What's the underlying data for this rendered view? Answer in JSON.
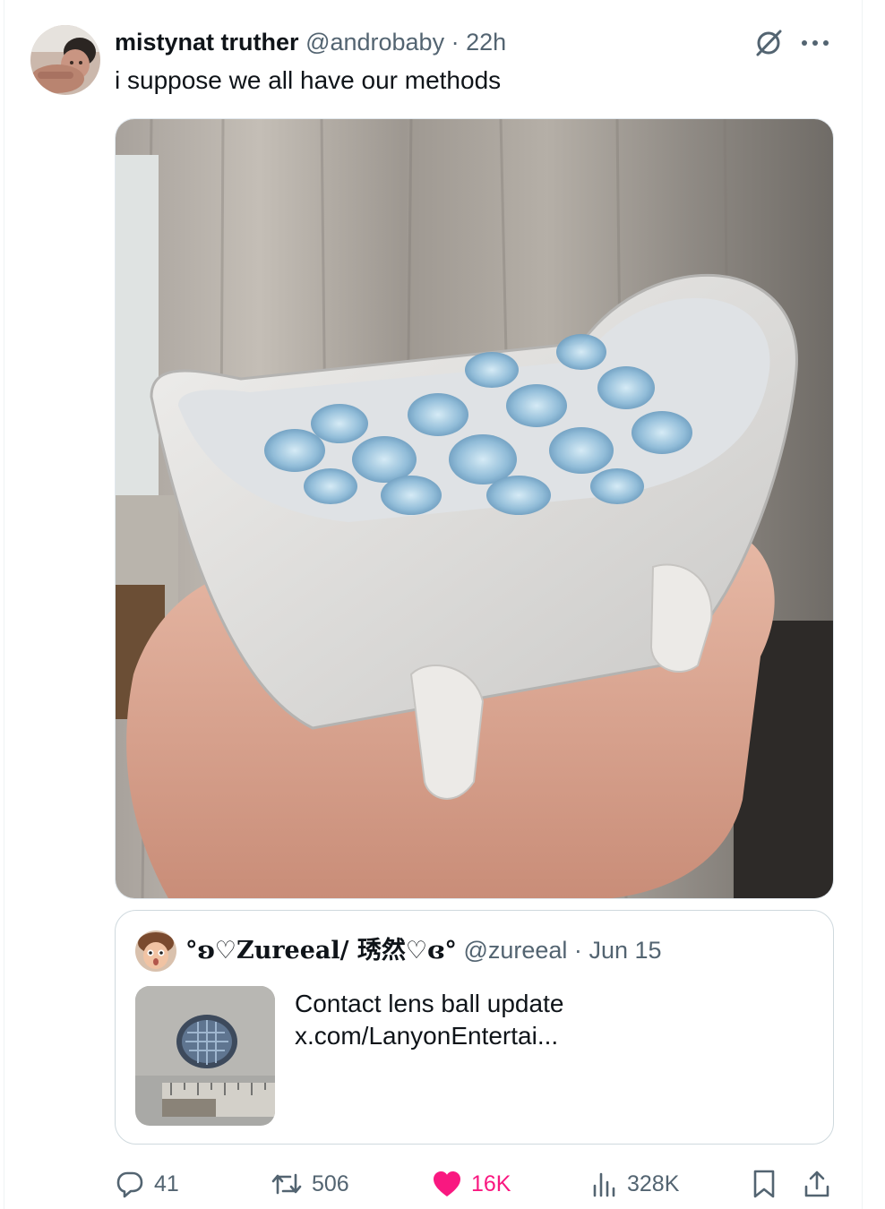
{
  "tweet": {
    "display_name": "mistynat truther",
    "handle": "@androbaby",
    "separator": "·",
    "time": "22h",
    "text": "i suppose we all have our methods",
    "header_icons": [
      "grok-icon",
      "more-icon"
    ]
  },
  "quote": {
    "display_name": "°ʚ♡Zureeal/ 琇然♡ɞ°",
    "handle": "@zureeal",
    "separator": "·",
    "date": "Jun 15",
    "text_line1": "Contact lens ball update",
    "text_line2": "x.com/LanyonEntertai..."
  },
  "actions": {
    "replies": "41",
    "reposts": "506",
    "likes": "16K",
    "views": "328K",
    "icons": [
      "reply-icon",
      "repost-icon",
      "like-icon",
      "views-icon",
      "bookmark-icon",
      "share-icon"
    ],
    "like_color": "#f91880",
    "muted_color": "#536471"
  }
}
